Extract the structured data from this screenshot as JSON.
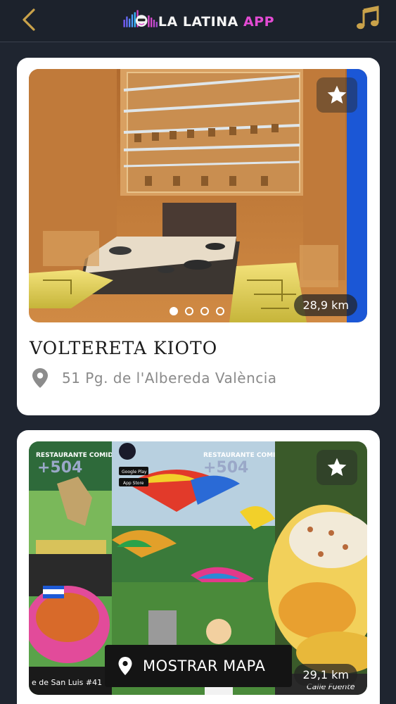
{
  "header": {
    "logo_text_main": "LA LATINA ",
    "logo_text_accent": "APP",
    "back_icon": "chevron-left-icon",
    "music_icon": "music-note-icon"
  },
  "colors": {
    "background": "#1f2530",
    "accent_gold": "#c9a24a",
    "logo_pink": "#e24bd3",
    "card": "#ffffff"
  },
  "restaurants": [
    {
      "name": "VOLTERETA KIOTO",
      "address": "51 Pg. de l'Albereda València",
      "distance": "28,9 km",
      "image_dots": 4,
      "active_dot": 0
    },
    {
      "distance": "29,1 km",
      "image_overlay_texts": [
        "RESTAURANTE COMIDAS",
        "+504",
        "RESTAURANTE COMIDAS",
        "+504",
        "e de San Luis #41",
        "Calle Fuente",
        "Google Play",
        "App Store",
        "LA LATINA APP"
      ]
    }
  ],
  "map_button": {
    "label": "MOSTRAR MAPA"
  }
}
